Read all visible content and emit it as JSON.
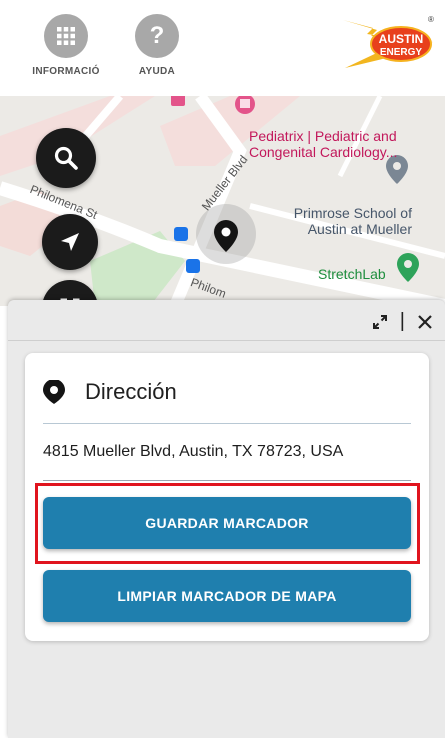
{
  "header": {
    "info_label": "INFORMACIÓ",
    "help_label": "AYUDA",
    "help_glyph": "?",
    "logo_line1": "AUSTIN",
    "logo_line2": "ENERGY",
    "logo_mark": "®"
  },
  "map": {
    "poi_pediatrix": "Pediatrix | Pediatric and Congenital Cardiology...",
    "poi_primrose_line1": "Primrose School of",
    "poi_primrose_line2": "Austin at Mueller",
    "poi_stretchlab": "StretchLab",
    "street_mueller": "Mueller Blvd",
    "street_philomena_1": "Philomena St",
    "street_philomena_2": "Philom"
  },
  "sheet": {
    "title": "Dirección",
    "address": "4815 Mueller Blvd, Austin, TX 78723, USA",
    "save_label": "GUARDAR MARCADOR",
    "clear_label": "LIMPIAR MARCADOR DE MAPA",
    "separator": "|"
  },
  "colors": {
    "button": "#1f7fae",
    "highlight": "#e0141e",
    "fab": "#1b1b1b"
  }
}
